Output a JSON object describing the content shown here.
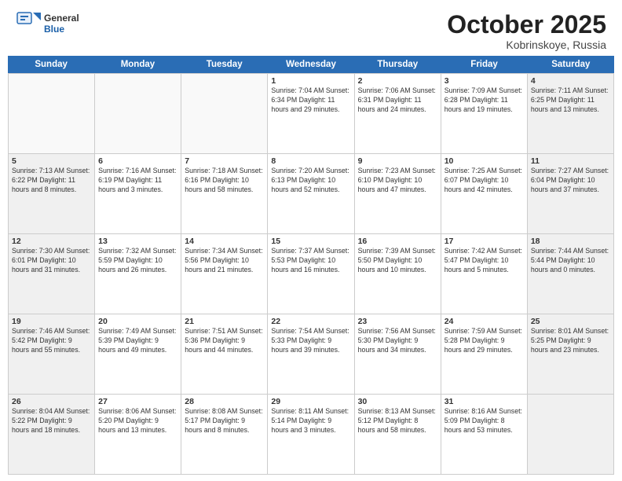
{
  "header": {
    "logo_general": "General",
    "logo_blue": "Blue",
    "title": "October 2025",
    "location": "Kobrinskoye, Russia"
  },
  "weekdays": [
    "Sunday",
    "Monday",
    "Tuesday",
    "Wednesday",
    "Thursday",
    "Friday",
    "Saturday"
  ],
  "rows": [
    [
      {
        "day": "",
        "text": "",
        "empty": true
      },
      {
        "day": "",
        "text": "",
        "empty": true
      },
      {
        "day": "",
        "text": "",
        "empty": true
      },
      {
        "day": "1",
        "text": "Sunrise: 7:04 AM\nSunset: 6:34 PM\nDaylight: 11 hours\nand 29 minutes.",
        "empty": false
      },
      {
        "day": "2",
        "text": "Sunrise: 7:06 AM\nSunset: 6:31 PM\nDaylight: 11 hours\nand 24 minutes.",
        "empty": false
      },
      {
        "day": "3",
        "text": "Sunrise: 7:09 AM\nSunset: 6:28 PM\nDaylight: 11 hours\nand 19 minutes.",
        "empty": false
      },
      {
        "day": "4",
        "text": "Sunrise: 7:11 AM\nSunset: 6:25 PM\nDaylight: 11 hours\nand 13 minutes.",
        "empty": false,
        "shaded": true
      }
    ],
    [
      {
        "day": "5",
        "text": "Sunrise: 7:13 AM\nSunset: 6:22 PM\nDaylight: 11 hours\nand 8 minutes.",
        "empty": false,
        "shaded": true
      },
      {
        "day": "6",
        "text": "Sunrise: 7:16 AM\nSunset: 6:19 PM\nDaylight: 11 hours\nand 3 minutes.",
        "empty": false
      },
      {
        "day": "7",
        "text": "Sunrise: 7:18 AM\nSunset: 6:16 PM\nDaylight: 10 hours\nand 58 minutes.",
        "empty": false
      },
      {
        "day": "8",
        "text": "Sunrise: 7:20 AM\nSunset: 6:13 PM\nDaylight: 10 hours\nand 52 minutes.",
        "empty": false
      },
      {
        "day": "9",
        "text": "Sunrise: 7:23 AM\nSunset: 6:10 PM\nDaylight: 10 hours\nand 47 minutes.",
        "empty": false
      },
      {
        "day": "10",
        "text": "Sunrise: 7:25 AM\nSunset: 6:07 PM\nDaylight: 10 hours\nand 42 minutes.",
        "empty": false
      },
      {
        "day": "11",
        "text": "Sunrise: 7:27 AM\nSunset: 6:04 PM\nDaylight: 10 hours\nand 37 minutes.",
        "empty": false,
        "shaded": true
      }
    ],
    [
      {
        "day": "12",
        "text": "Sunrise: 7:30 AM\nSunset: 6:01 PM\nDaylight: 10 hours\nand 31 minutes.",
        "empty": false,
        "shaded": true
      },
      {
        "day": "13",
        "text": "Sunrise: 7:32 AM\nSunset: 5:59 PM\nDaylight: 10 hours\nand 26 minutes.",
        "empty": false
      },
      {
        "day": "14",
        "text": "Sunrise: 7:34 AM\nSunset: 5:56 PM\nDaylight: 10 hours\nand 21 minutes.",
        "empty": false
      },
      {
        "day": "15",
        "text": "Sunrise: 7:37 AM\nSunset: 5:53 PM\nDaylight: 10 hours\nand 16 minutes.",
        "empty": false
      },
      {
        "day": "16",
        "text": "Sunrise: 7:39 AM\nSunset: 5:50 PM\nDaylight: 10 hours\nand 10 minutes.",
        "empty": false
      },
      {
        "day": "17",
        "text": "Sunrise: 7:42 AM\nSunset: 5:47 PM\nDaylight: 10 hours\nand 5 minutes.",
        "empty": false
      },
      {
        "day": "18",
        "text": "Sunrise: 7:44 AM\nSunset: 5:44 PM\nDaylight: 10 hours\nand 0 minutes.",
        "empty": false,
        "shaded": true
      }
    ],
    [
      {
        "day": "19",
        "text": "Sunrise: 7:46 AM\nSunset: 5:42 PM\nDaylight: 9 hours\nand 55 minutes.",
        "empty": false,
        "shaded": true
      },
      {
        "day": "20",
        "text": "Sunrise: 7:49 AM\nSunset: 5:39 PM\nDaylight: 9 hours\nand 49 minutes.",
        "empty": false
      },
      {
        "day": "21",
        "text": "Sunrise: 7:51 AM\nSunset: 5:36 PM\nDaylight: 9 hours\nand 44 minutes.",
        "empty": false
      },
      {
        "day": "22",
        "text": "Sunrise: 7:54 AM\nSunset: 5:33 PM\nDaylight: 9 hours\nand 39 minutes.",
        "empty": false
      },
      {
        "day": "23",
        "text": "Sunrise: 7:56 AM\nSunset: 5:30 PM\nDaylight: 9 hours\nand 34 minutes.",
        "empty": false
      },
      {
        "day": "24",
        "text": "Sunrise: 7:59 AM\nSunset: 5:28 PM\nDaylight: 9 hours\nand 29 minutes.",
        "empty": false
      },
      {
        "day": "25",
        "text": "Sunrise: 8:01 AM\nSunset: 5:25 PM\nDaylight: 9 hours\nand 23 minutes.",
        "empty": false,
        "shaded": true
      }
    ],
    [
      {
        "day": "26",
        "text": "Sunrise: 8:04 AM\nSunset: 5:22 PM\nDaylight: 9 hours\nand 18 minutes.",
        "empty": false,
        "shaded": true
      },
      {
        "day": "27",
        "text": "Sunrise: 8:06 AM\nSunset: 5:20 PM\nDaylight: 9 hours\nand 13 minutes.",
        "empty": false
      },
      {
        "day": "28",
        "text": "Sunrise: 8:08 AM\nSunset: 5:17 PM\nDaylight: 9 hours\nand 8 minutes.",
        "empty": false
      },
      {
        "day": "29",
        "text": "Sunrise: 8:11 AM\nSunset: 5:14 PM\nDaylight: 9 hours\nand 3 minutes.",
        "empty": false
      },
      {
        "day": "30",
        "text": "Sunrise: 8:13 AM\nSunset: 5:12 PM\nDaylight: 8 hours\nand 58 minutes.",
        "empty": false
      },
      {
        "day": "31",
        "text": "Sunrise: 8:16 AM\nSunset: 5:09 PM\nDaylight: 8 hours\nand 53 minutes.",
        "empty": false
      },
      {
        "day": "",
        "text": "",
        "empty": true,
        "shaded": true
      }
    ]
  ]
}
